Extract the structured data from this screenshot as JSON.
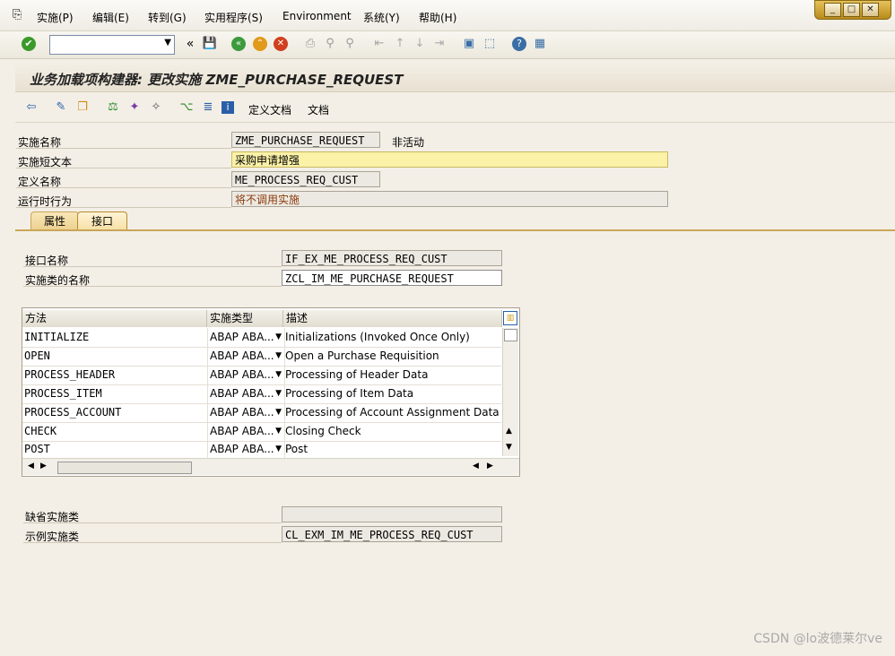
{
  "menu": [
    "实施(P)",
    "编辑(E)",
    "转到(G)",
    "实用程序(S)",
    "Environment",
    "系统(Y)",
    "帮助(H)"
  ],
  "window_controls": {
    "minimize": "_",
    "maximize": "□",
    "close": "✕"
  },
  "toolbar": {
    "back_double": "«"
  },
  "title": "业务加载项构建器: 更改实施 ZME_PURCHASE_REQUEST",
  "app_toolbar": {
    "define_doc": "定义文档",
    "doc": "文档"
  },
  "form": {
    "impl_name_label": "实施名称",
    "impl_name_value": "ZME_PURCHASE_REQUEST",
    "impl_status": "非活动",
    "short_text_label": "实施短文本",
    "short_text_value": "采购申请增强",
    "def_name_label": "定义名称",
    "def_name_value": "ME_PROCESS_REQ_CUST",
    "runtime_label": "运行时行为",
    "runtime_value": "将不调用实施"
  },
  "tabs": {
    "attributes": "属性",
    "interface": "接口"
  },
  "interface": {
    "intf_name_label": "接口名称",
    "intf_name_value": "IF_EX_ME_PROCESS_REQ_CUST",
    "class_name_label": "实施类的名称",
    "class_name_value": "ZCL_IM_ME_PURCHASE_REQUEST"
  },
  "table": {
    "headers": {
      "method": "方法",
      "type": "实施类型",
      "desc": "描述"
    },
    "rows": [
      {
        "method": "INITIALIZE",
        "type": "ABAP ABA...",
        "desc": "Initializations (Invoked Once Only)"
      },
      {
        "method": "OPEN",
        "type": "ABAP ABA...",
        "desc": "Open a Purchase Requisition"
      },
      {
        "method": "PROCESS_HEADER",
        "type": "ABAP ABA...",
        "desc": "Processing of Header Data"
      },
      {
        "method": "PROCESS_ITEM",
        "type": "ABAP ABA...",
        "desc": "Processing of Item Data"
      },
      {
        "method": "PROCESS_ACCOUNT",
        "type": "ABAP ABA...",
        "desc": "Processing of Account Assignment Data"
      },
      {
        "method": "CHECK",
        "type": "ABAP ABA...",
        "desc": "Closing Check"
      },
      {
        "method": "POST",
        "type": "ABAP ABA...",
        "desc": "Post"
      }
    ]
  },
  "defaults": {
    "default_class_label": "缺省实施类",
    "default_class_value": "",
    "example_class_label": "示例实施类",
    "example_class_value": "CL_EXM_IM_ME_PROCESS_REQ_CUST"
  },
  "watermark": "CSDN @lo波德莱尔ve",
  "colors": {
    "title_bg": "#ede7da",
    "tab_active": "#f6dfa4",
    "highlight_field": "#fbf2a8"
  }
}
